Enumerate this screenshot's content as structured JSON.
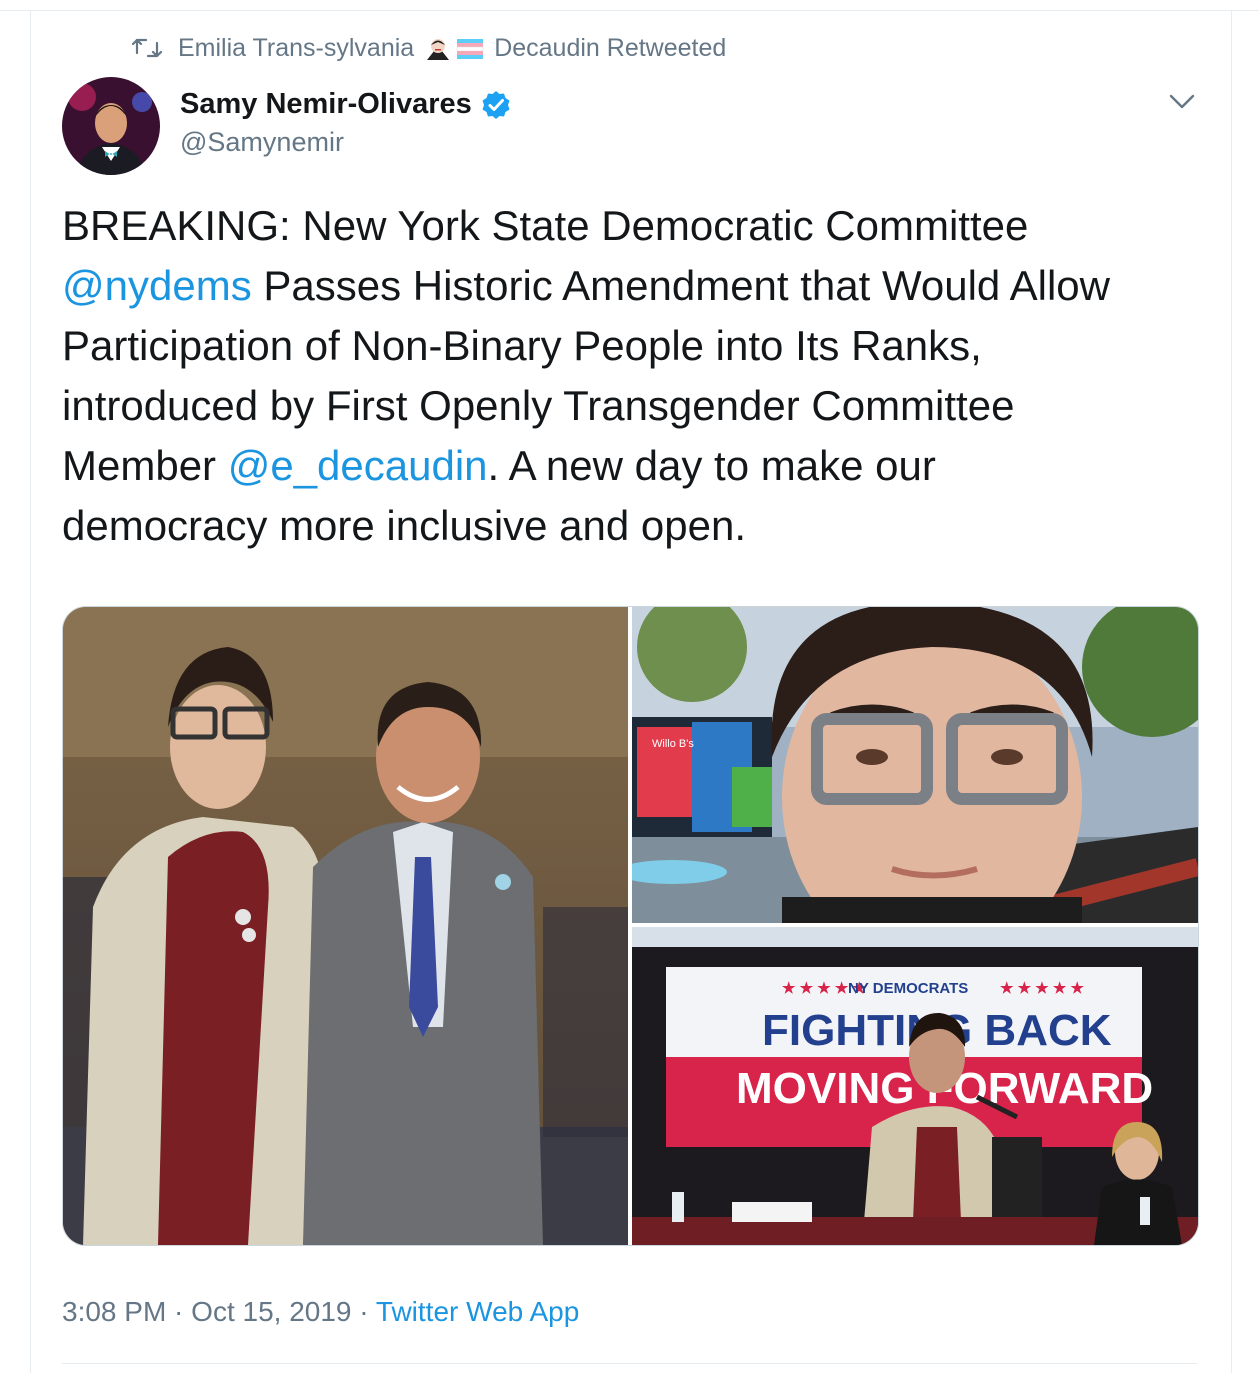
{
  "retweet_context": {
    "retweeter": "Emilia Trans-sylvania",
    "suffix": "Decaudin Retweeted"
  },
  "author": {
    "name": "Samy Nemir-Olivares",
    "handle": "@Samynemir",
    "verified": true
  },
  "tweet": {
    "lines": [
      [
        {
          "t": "BREAKING: New York State Democratic Committee"
        }
      ],
      [
        {
          "t": "@nydems",
          "mention": true
        },
        {
          "t": " Passes Historic Amendment that Would Allow"
        }
      ],
      [
        {
          "t": "Participation of Non-Binary People into Its Ranks,"
        }
      ],
      [
        {
          "t": "introduced by First Openly Transgender Committee"
        }
      ],
      [
        {
          "t": "Member "
        },
        {
          "t": "@e_decaudin",
          "mention": true
        },
        {
          "t": ". A new day to make our"
        }
      ],
      [
        {
          "t": "democracy more inclusive and open."
        }
      ]
    ]
  },
  "media": {
    "banner_top": "NY DEMOCRATS",
    "banner_line1": "FIGHTING BACK",
    "banner_line2": "MOVING FORWARD",
    "storefront_sign": "Willo B's"
  },
  "meta": {
    "time": "3:08 PM",
    "date": "Oct 15, 2019",
    "separator": " · ",
    "app": "Twitter Web App"
  },
  "colors": {
    "link": "#1b95e0",
    "secondary_text": "#657786",
    "verified": "#1da1f2",
    "banner_red": "#d8244a",
    "banner_blue": "#23408e"
  },
  "icons": {
    "retweet": "retweet-icon",
    "verified": "verified-badge-icon",
    "caret": "chevron-down-icon"
  }
}
